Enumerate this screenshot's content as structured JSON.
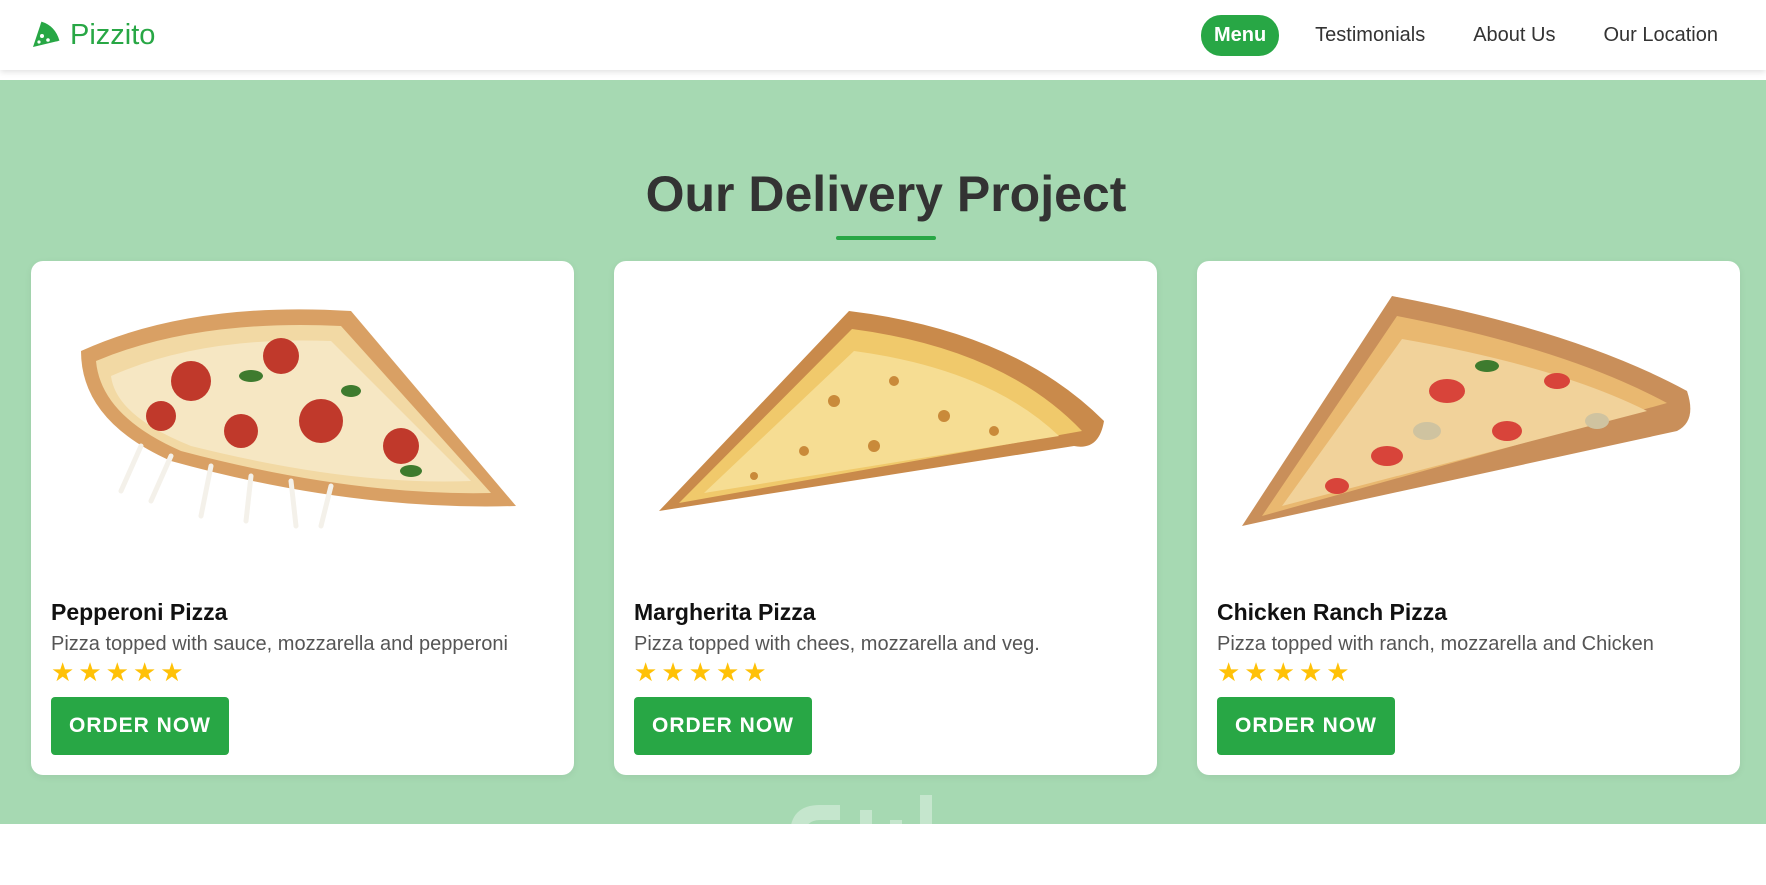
{
  "brand": {
    "name": "Pizzito",
    "icon": "pizza-slice-icon"
  },
  "nav": {
    "items": [
      {
        "label": "Menu",
        "active": true
      },
      {
        "label": "Testimonials",
        "active": false
      },
      {
        "label": "About Us",
        "active": false
      },
      {
        "label": "Our Location",
        "active": false
      }
    ]
  },
  "section": {
    "title": "Our Delivery Project"
  },
  "cards": [
    {
      "name": "Pepperoni Pizza",
      "description": "Pizza topped with sauce, mozzarella and pepperoni",
      "rating": 5,
      "button": "ORDER NOW",
      "image": "pepperoni-pizza-slice"
    },
    {
      "name": "Margherita Pizza",
      "description": "Pizza topped with chees, mozzarella and veg.",
      "rating": 5,
      "button": "ORDER NOW",
      "image": "margherita-pizza-slice"
    },
    {
      "name": "Chicken Ranch Pizza",
      "description": "Pizza topped with ranch, mozzarella and Chicken",
      "rating": 5,
      "button": "ORDER NOW",
      "image": "chicken-ranch-pizza-slice"
    }
  ],
  "colors": {
    "accent": "#28a745",
    "section_bg": "#a6d9b2",
    "star": "#ffc107",
    "text_dark": "#333333"
  }
}
